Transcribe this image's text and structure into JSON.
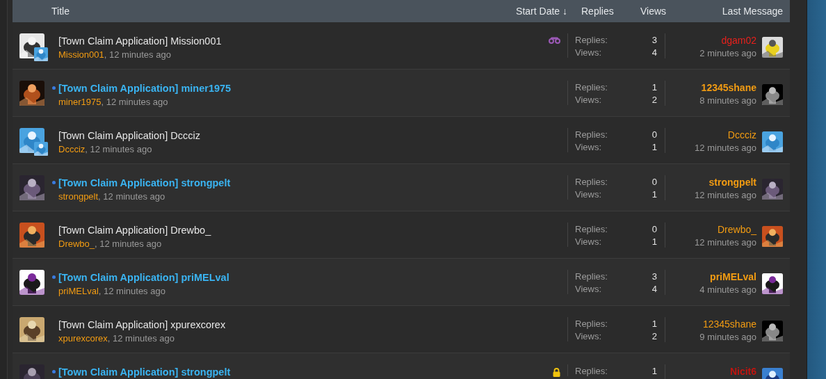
{
  "header": {
    "title": "Title",
    "start_date": "Start Date ↓",
    "replies": "Replies",
    "views": "Views",
    "last_message": "Last Message"
  },
  "threads": [
    {
      "title": "[Town Claim Application] Mission001",
      "unread": false,
      "watched": true,
      "locked": false,
      "author": "Mission001",
      "time": ", 12 minutes ago",
      "badge": true,
      "replies_label": "Replies:",
      "replies": "3",
      "views_label": "Views:",
      "views": "4",
      "last_user": "dgam02",
      "color": "#e8201c",
      "last_time": "2 minutes ago"
    },
    {
      "title": "[Town Claim Application] miner1975",
      "unread": true,
      "watched": false,
      "locked": false,
      "author": "miner1975",
      "time": ", 12 minutes ago",
      "badge": false,
      "replies_label": "Replies:",
      "replies": "1",
      "views_label": "Views:",
      "views": "2",
      "last_user": "12345shane",
      "color": "#f39c12",
      "last_time": "8 minutes ago"
    },
    {
      "title": "[Town Claim Application] Dccciz",
      "unread": false,
      "watched": false,
      "locked": false,
      "author": "Dccciz",
      "time": ", 12 minutes ago",
      "badge": true,
      "replies_label": "Replies:",
      "replies": "0",
      "views_label": "Views:",
      "views": "1",
      "last_user": "Dccciz",
      "color": "#f39c12",
      "last_time": "12 minutes ago"
    },
    {
      "title": "[Town Claim Application] strongpelt",
      "unread": true,
      "watched": false,
      "locked": false,
      "author": "strongpelt",
      "time": ", 12 minutes ago",
      "badge": false,
      "replies_label": "Replies:",
      "replies": "0",
      "views_label": "Views:",
      "views": "1",
      "last_user": "strongpelt",
      "color": "#f39c12",
      "last_time": "12 minutes ago"
    },
    {
      "title": "[Town Claim Application] Drewbo_",
      "unread": false,
      "watched": false,
      "locked": false,
      "author": "Drewbo_",
      "time": ", 12 minutes ago",
      "badge": false,
      "replies_label": "Replies:",
      "replies": "0",
      "views_label": "Views:",
      "views": "1",
      "last_user": "Drewbo_",
      "color": "#f39c12",
      "last_time": "12 minutes ago"
    },
    {
      "title": "[Town Claim Application] priMELval",
      "unread": true,
      "watched": false,
      "locked": false,
      "author": "priMELval",
      "time": ", 12 minutes ago",
      "badge": false,
      "replies_label": "Replies:",
      "replies": "3",
      "views_label": "Views:",
      "views": "4",
      "last_user": "priMELval",
      "color": "#f39c12",
      "last_time": "4 minutes ago"
    },
    {
      "title": "[Town Claim Application] xpurexcorex",
      "unread": false,
      "watched": false,
      "locked": false,
      "author": "xpurexcorex",
      "time": ", 12 minutes ago",
      "badge": false,
      "replies_label": "Replies:",
      "replies": "1",
      "views_label": "Views:",
      "views": "2",
      "last_user": "12345shane",
      "color": "#f39c12",
      "last_time": "9 minutes ago"
    },
    {
      "title": "[Town Claim Application] strongpelt",
      "unread": true,
      "watched": false,
      "locked": true,
      "badge": false,
      "replies_label": "Replies:",
      "replies": "1",
      "last_user": "Nicit6",
      "color": "#c0140f"
    }
  ]
}
